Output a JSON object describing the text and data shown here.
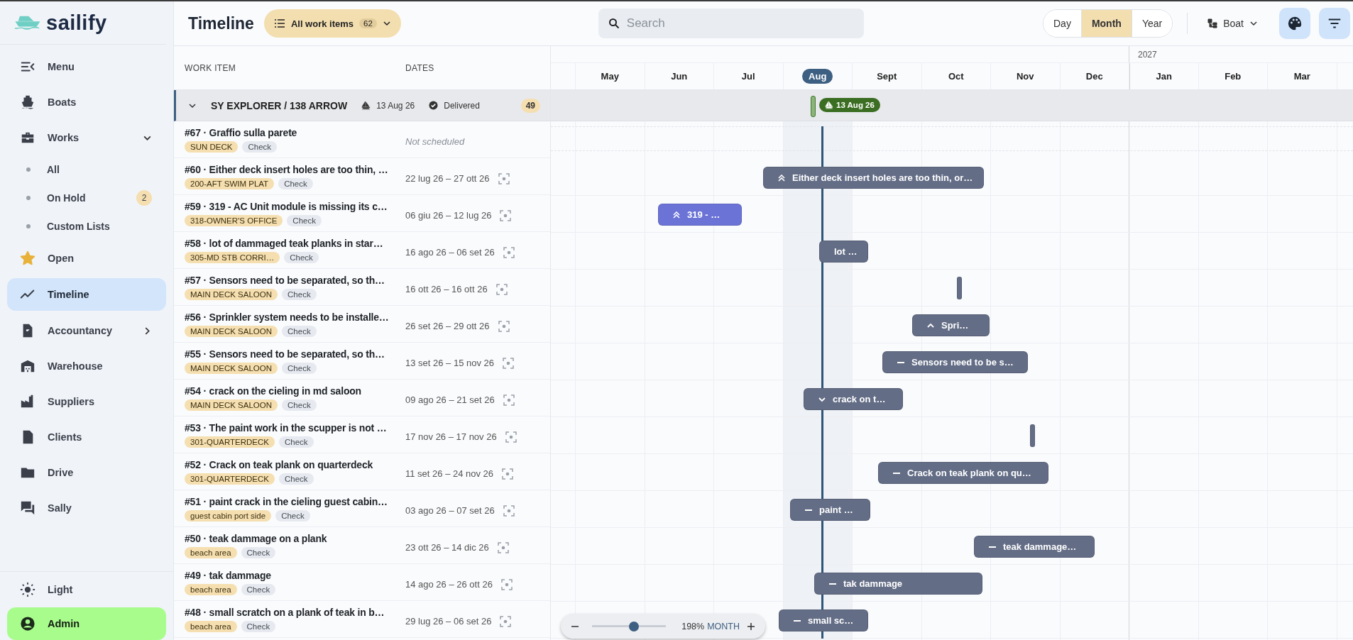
{
  "brand": {
    "name": "sailify"
  },
  "sidebar": {
    "items": [
      {
        "label": "Menu",
        "selected": false
      },
      {
        "label": "Boats",
        "selected": false
      },
      {
        "label": "Works",
        "selected": false,
        "expanded": true,
        "children": [
          {
            "label": "All",
            "selected": false
          },
          {
            "label": "On Hold",
            "selected": false,
            "badge": "2"
          },
          {
            "label": "Custom Lists",
            "selected": false
          }
        ]
      },
      {
        "label": "Open",
        "selected": false
      },
      {
        "label": "Timeline",
        "selected": true
      },
      {
        "label": "Accountancy",
        "selected": false,
        "expanded": false
      },
      {
        "label": "Warehouse",
        "selected": false
      },
      {
        "label": "Suppliers",
        "selected": false
      },
      {
        "label": "Clients",
        "selected": false
      },
      {
        "label": "Drive",
        "selected": false
      },
      {
        "label": "Sally",
        "selected": false
      }
    ],
    "footer": [
      {
        "label": "Light"
      },
      {
        "label": "Admin"
      }
    ]
  },
  "header": {
    "title": "Timeline",
    "filter": {
      "label": "All work items",
      "count": "62"
    },
    "search": {
      "placeholder": "Search"
    },
    "views": [
      {
        "label": "Day",
        "selected": false
      },
      {
        "label": "Month",
        "selected": true
      },
      {
        "label": "Year",
        "selected": false
      }
    ],
    "group_by": {
      "label": "Boat"
    }
  },
  "table": {
    "columns": [
      "WORK ITEM",
      "DATES"
    ],
    "group": {
      "title": "SY EXPLORER / 138 ARROW",
      "date": "13 Aug 26",
      "status": "Delivered",
      "count": "49",
      "expanded": true,
      "milestone": "13 Aug 26"
    },
    "rows": [
      {
        "title": "#67 · Graffio sulla parete",
        "area": "SUN DECK",
        "type": "Check",
        "dates": "Not scheduled",
        "scheduled": false
      },
      {
        "title": "#60 · Either deck insert holes are too thin, …",
        "area": "200-AFT SWIM PLAT",
        "type": "Check",
        "dates": "22 lug 26 – 27 ott 26",
        "scheduled": true,
        "bar": {
          "kind": "double-up",
          "label": "Either deck insert holes are too thin, or…",
          "color": "#636d86"
        }
      },
      {
        "title": "#59 · 319 - AC Unit module is missing its c…",
        "area": "318-OWNER'S OFFICE",
        "type": "Check",
        "dates": "06 giu 26 – 12 lug 26",
        "scheduled": true,
        "bar": {
          "kind": "double-up",
          "label": "319 - …",
          "color": "#6b74d6"
        }
      },
      {
        "title": "#58 · lot of dammaged teak planks in star…",
        "area": "305-MD STB CORRI…",
        "type": "Check",
        "dates": "16 ago 26 – 06 set 26",
        "scheduled": true,
        "bar": {
          "kind": "plain",
          "label": "lot …",
          "color": "#636d86"
        }
      },
      {
        "title": "#57 · Sensors need to be separated, so th…",
        "area": "MAIN DECK SALOON",
        "type": "Check",
        "dates": "16 ott 26 – 16 ott 26",
        "scheduled": true,
        "bar": {
          "kind": "tick",
          "color": "#636d86"
        }
      },
      {
        "title": "#56 · Sprinkler system needs to be installe…",
        "area": "MAIN DECK SALOON",
        "type": "Check",
        "dates": "26 set 26 – 29 ott 26",
        "scheduled": true,
        "bar": {
          "kind": "up",
          "label": "Spri…",
          "color": "#636d86"
        }
      },
      {
        "title": "#55 · Sensors need to be separated, so th…",
        "area": "MAIN DECK SALOON",
        "type": "Check",
        "dates": "13 set 26 – 15 nov 26",
        "scheduled": true,
        "bar": {
          "kind": "dash",
          "label": "Sensors need to be s…",
          "color": "#636d86"
        }
      },
      {
        "title": "#54 · crack on the cieling in md saloon",
        "area": "MAIN DECK SALOON",
        "type": "Check",
        "dates": "09 ago 26 – 21 set 26",
        "scheduled": true,
        "bar": {
          "kind": "down",
          "label": "crack on t…",
          "color": "#636d86"
        }
      },
      {
        "title": "#53 · The paint work in the scupper is not …",
        "area": "301-QUARTERDECK",
        "type": "Check",
        "dates": "17 nov 26 – 17 nov 26",
        "scheduled": true,
        "bar": {
          "kind": "tick",
          "color": "#636d86"
        }
      },
      {
        "title": "#52 · Crack on teak plank on quarterdeck",
        "area": "301-QUARTERDECK",
        "type": "Check",
        "dates": "11 set 26 – 24 nov 26",
        "scheduled": true,
        "bar": {
          "kind": "dash",
          "label": "Crack on teak plank on qu…",
          "color": "#636d86"
        }
      },
      {
        "title": "#51 · paint crack in the cieling guest cabin…",
        "area": "guest cabin port side",
        "type": "Check",
        "dates": "03 ago 26 – 07 set 26",
        "scheduled": true,
        "bar": {
          "kind": "dash",
          "label": "paint …",
          "color": "#636d86"
        }
      },
      {
        "title": "#50 · teak dammage on a plank",
        "area": "beach area",
        "type": "Check",
        "dates": "23 ott 26 – 14 dic 26",
        "scheduled": true,
        "bar": {
          "kind": "dash",
          "label": "teak dammage…",
          "color": "#636d86"
        }
      },
      {
        "title": "#49 · tak dammage",
        "area": "beach area",
        "type": "Check",
        "dates": "14 ago 26 – 26 ott 26",
        "scheduled": true,
        "bar": {
          "kind": "dash",
          "label": "tak dammage",
          "color": "#636d86"
        }
      },
      {
        "title": "#48 · small scratch on a plank of teak in b…",
        "area": "beach area",
        "type": "Check",
        "dates": "29 lug 26 – 06 set 26",
        "scheduled": true,
        "bar": {
          "kind": "dash",
          "label": "small sc…",
          "color": "#636d86"
        }
      }
    ]
  },
  "timeline": {
    "year": "2027",
    "months": [
      {
        "label": "May",
        "selected": false
      },
      {
        "label": "Jun",
        "selected": false
      },
      {
        "label": "Jul",
        "selected": false
      },
      {
        "label": "Aug",
        "selected": true
      },
      {
        "label": "Sept",
        "selected": false
      },
      {
        "label": "Oct",
        "selected": false
      },
      {
        "label": "Nov",
        "selected": false
      },
      {
        "label": "Dec",
        "selected": false
      },
      {
        "label": "Jan",
        "selected": false
      },
      {
        "label": "Feb",
        "selected": false
      },
      {
        "label": "Mar",
        "selected": false
      }
    ],
    "zoom": {
      "level": 0.57,
      "percent": "198%",
      "unit": "MONTH"
    }
  }
}
